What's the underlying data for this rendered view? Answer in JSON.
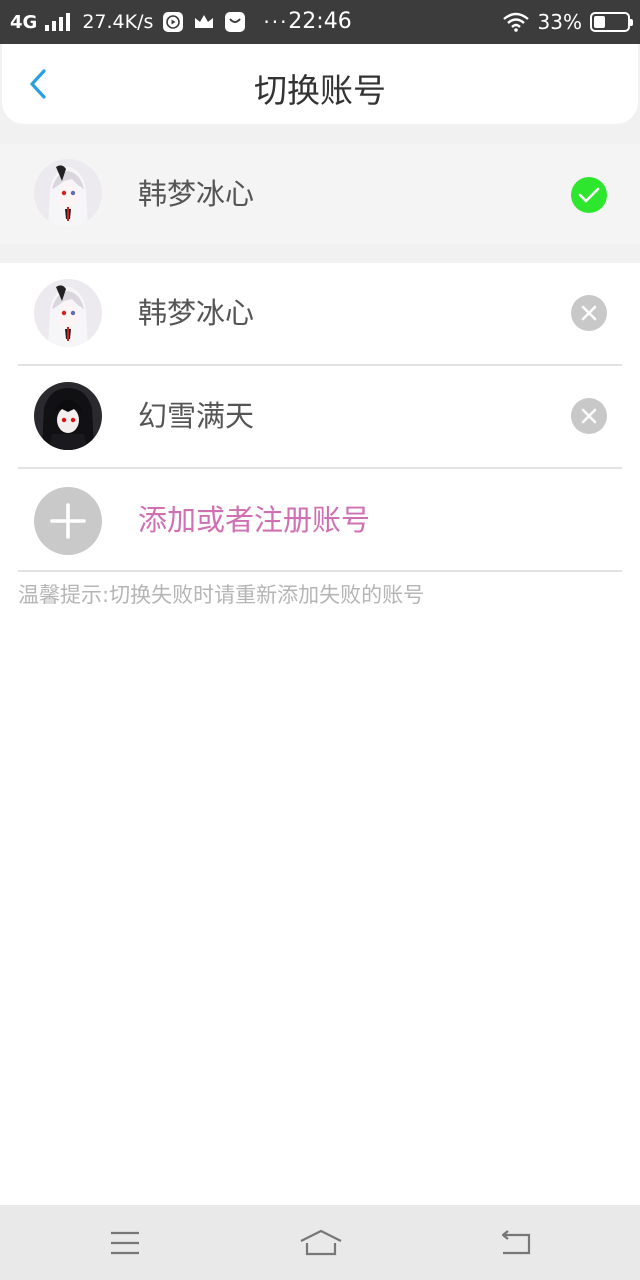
{
  "status_bar": {
    "network": "4G",
    "speed": "27.4K/s",
    "more": "···",
    "time": "22:46",
    "battery_text": "33%",
    "battery_level": 0.33
  },
  "header": {
    "title": "切换账号",
    "back_icon": "chevron-left-icon"
  },
  "current_account": {
    "name": "韩梦冰心",
    "status_icon": "check-circle-icon"
  },
  "accounts": [
    {
      "name": "韩梦冰心",
      "action_icon": "remove-circle-icon"
    },
    {
      "name": "幻雪满天",
      "action_icon": "remove-circle-icon"
    }
  ],
  "add_account": {
    "label": "添加或者注册账号",
    "icon": "plus-icon"
  },
  "tip": "温馨提示:切换失败时请重新添加失败的账号",
  "nav_bar": {
    "menu_icon": "menu-icon",
    "home_icon": "home-icon",
    "back_icon": "back-icon"
  },
  "colors": {
    "accent_blue": "#2a9fe0",
    "check_green": "#2ee62e",
    "add_pink": "#d070b3"
  }
}
